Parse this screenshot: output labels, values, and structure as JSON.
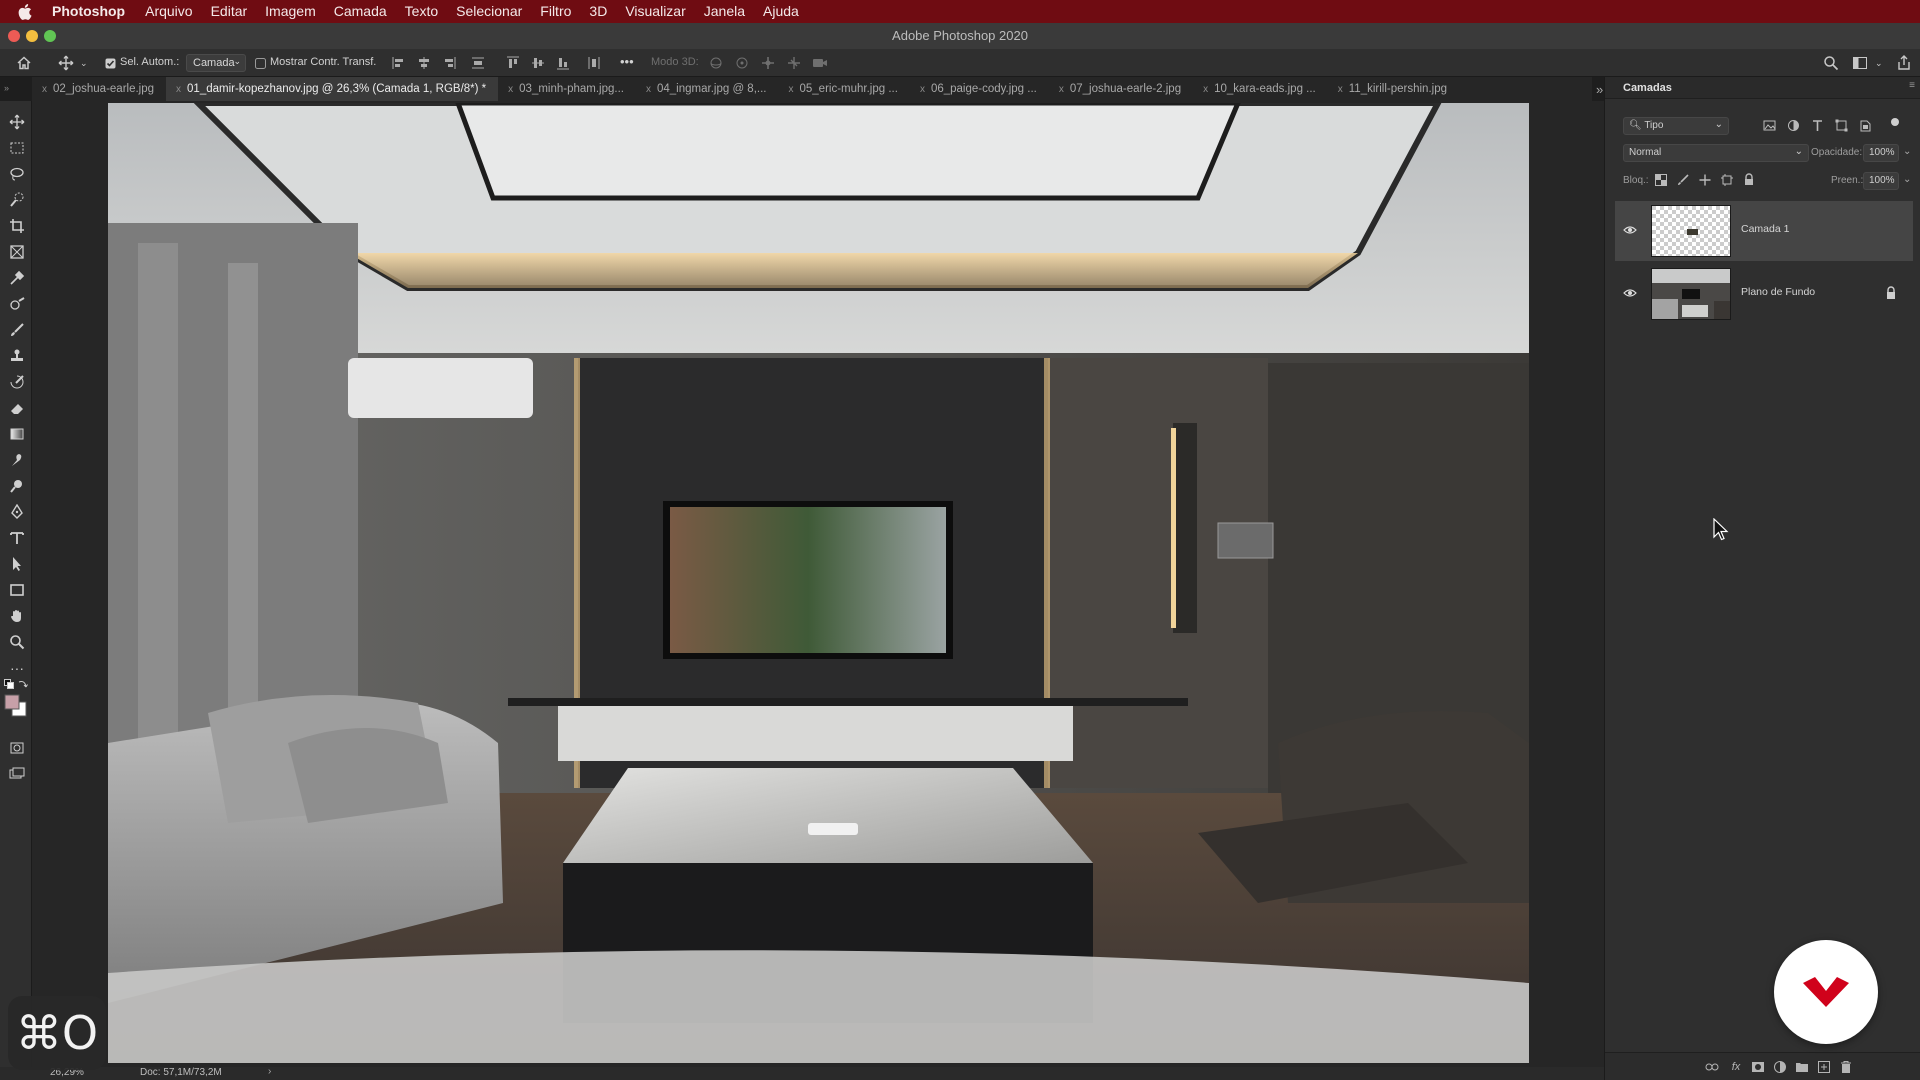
{
  "menubar": {
    "app_name": "Photoshop",
    "items": [
      "Arquivo",
      "Editar",
      "Imagem",
      "Camada",
      "Texto",
      "Selecionar",
      "Filtro",
      "3D",
      "Visualizar",
      "Janela",
      "Ajuda"
    ]
  },
  "window": {
    "title": "Adobe Photoshop 2020"
  },
  "options_bar": {
    "auto_select_label": "Sel. Autom.:",
    "auto_select_checked": true,
    "auto_select_target": "Camada",
    "show_transform_label": "Mostrar Contr. Transf.",
    "show_transform_checked": false,
    "mode_3d_label": "Modo 3D:",
    "more_label": "•••"
  },
  "tabs": [
    {
      "label": "02_joshua-earle.jpg",
      "active": false
    },
    {
      "label": "01_damir-kopezhanov.jpg @ 26,3% (Camada 1, RGB/8*) *",
      "active": true
    },
    {
      "label": "03_minh-pham.jpg...",
      "active": false
    },
    {
      "label": "04_ingmar.jpg @ 8,...",
      "active": false
    },
    {
      "label": "05_eric-muhr.jpg ...",
      "active": false
    },
    {
      "label": "06_paige-cody.jpg ...",
      "active": false
    },
    {
      "label": "07_joshua-earle-2.jpg",
      "active": false
    },
    {
      "label": "10_kara-eads.jpg ...",
      "active": false
    },
    {
      "label": "11_kirill-pershin.jpg",
      "active": false
    }
  ],
  "tabs_more": "»",
  "layers_panel": {
    "title": "Camadas",
    "filter_label": "Tipo",
    "blend_mode": "Normal",
    "opacity_label": "Opacidade:",
    "opacity_value": "100%",
    "lock_label": "Bloq.:",
    "fill_label": "Preen.:",
    "fill_value": "100%",
    "layers": [
      {
        "name": "Camada 1",
        "visible": true,
        "selected": true,
        "locked": false
      },
      {
        "name": "Plano de Fundo",
        "visible": true,
        "selected": false,
        "locked": true
      }
    ]
  },
  "status_bar": {
    "zoom": "26,29%",
    "doc_info": "Doc: 57,1M/73,2M",
    "arrow": "›"
  },
  "overlay": {
    "shortcut_text": "⌘O"
  },
  "colors": {
    "menubar_bg": "#6f0c12",
    "foreground_swatch": "#c7a0a8",
    "background_swatch": "#ffffff",
    "badge_accent": "#d0021b"
  }
}
